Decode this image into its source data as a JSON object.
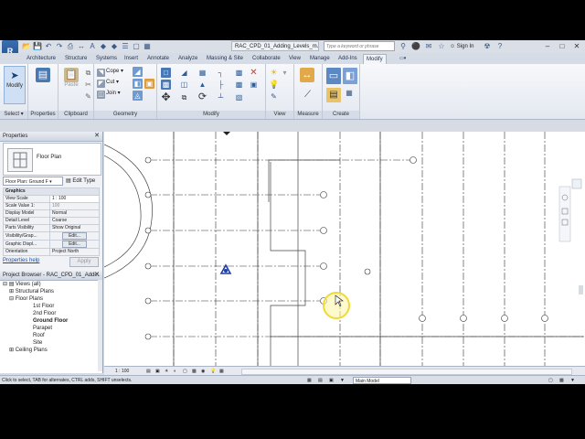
{
  "app": {
    "logo": "R",
    "document_tab": "RAC_CPD_01_Adding_Levels_m...",
    "search_placeholder": "Type a keyword or phrase",
    "sign_in": "Sign In"
  },
  "tabs": [
    "Architecture",
    "Structure",
    "Systems",
    "Insert",
    "Annotate",
    "Analyze",
    "Massing & Site",
    "Collaborate",
    "View",
    "Manage",
    "Add-Ins",
    "Modify"
  ],
  "active_tab": "Modify",
  "ribbon": {
    "select": {
      "button": "Modify",
      "label": "Select"
    },
    "properties": {
      "button": "Properties",
      "label": "Properties"
    },
    "clipboard": {
      "paste": "Paste",
      "label": "Clipboard"
    },
    "geometry": {
      "cope": "Cope",
      "cut": "Cut",
      "join": "Join",
      "label": "Geometry"
    },
    "modify": {
      "label": "Modify"
    },
    "view": {
      "label": "View"
    },
    "measure": {
      "label": "Measure"
    },
    "create": {
      "label": "Create"
    }
  },
  "properties_panel": {
    "title": "Properties",
    "type_name": "Floor Plan",
    "instance_selector": "Floor Plan: Ground F",
    "edit_type": "Edit Type",
    "group": "Graphics",
    "rows": [
      {
        "name": "View Scale",
        "value": "1 : 100"
      },
      {
        "name": "Scale Value    1:",
        "value": "100"
      },
      {
        "name": "Display Model",
        "value": "Normal"
      },
      {
        "name": "Detail Level",
        "value": "Coarse"
      },
      {
        "name": "Parts Visibility",
        "value": "Show Original"
      },
      {
        "name": "Visibility/Grap...",
        "value": "Edit..."
      },
      {
        "name": "Graphic Displ...",
        "value": "Edit..."
      },
      {
        "name": "Orientation",
        "value": "Project North"
      }
    ],
    "help_link": "Properties help",
    "apply": "Apply"
  },
  "project_browser": {
    "title": "Project Browser - RAC_CPD_01_Addi...",
    "items": [
      {
        "label": "Views (all)",
        "level": 0,
        "toggle": "-"
      },
      {
        "label": "Structural Plans",
        "level": 1,
        "toggle": "+"
      },
      {
        "label": "Floor Plans",
        "level": 1,
        "toggle": "-"
      },
      {
        "label": "1st Floor",
        "level": 2,
        "toggle": ""
      },
      {
        "label": "2nd Floor",
        "level": 2,
        "toggle": ""
      },
      {
        "label": "Ground Floor",
        "level": 2,
        "toggle": "",
        "bold": true
      },
      {
        "label": "Parapet",
        "level": 2,
        "toggle": ""
      },
      {
        "label": "Roof",
        "level": 2,
        "toggle": ""
      },
      {
        "label": "Site",
        "level": 2,
        "toggle": ""
      },
      {
        "label": "Ceiling Plans",
        "level": 1,
        "toggle": "+"
      }
    ]
  },
  "view_control": {
    "scale": "1 : 100"
  },
  "status_bar": {
    "hint": "Click to select, TAB for alternates, CTRL adds, SHIFT unselects.",
    "model": "Main Model"
  }
}
